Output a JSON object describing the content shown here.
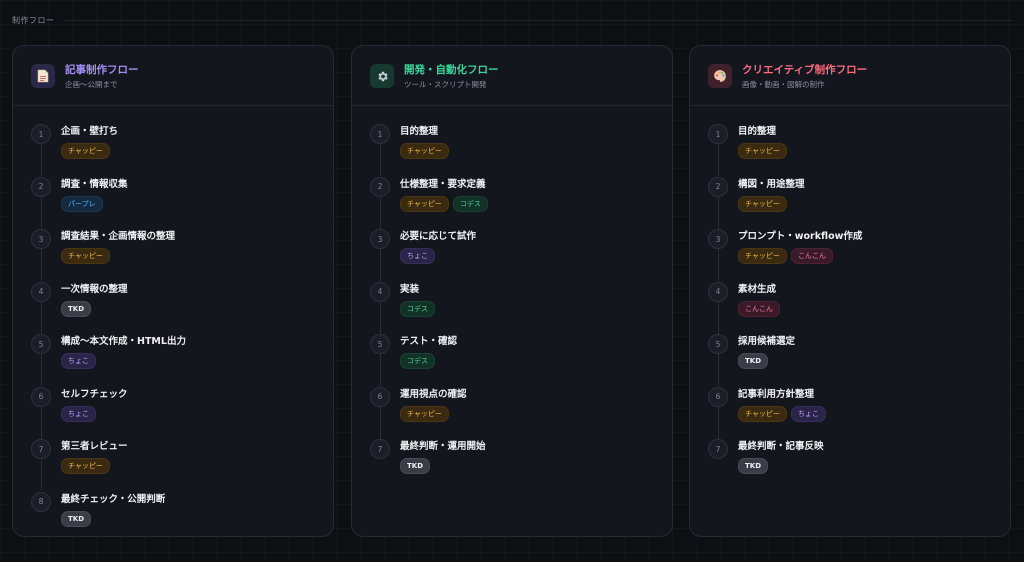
{
  "section": {
    "title": "制作フロー"
  },
  "colors": {
    "article": "#a48df0",
    "dev": "#39d59a",
    "creative": "#ff6b81"
  },
  "cards": [
    {
      "icon": "document-icon",
      "title": "記事制作フロー",
      "subtitle": "企画〜公開まで",
      "steps": [
        {
          "num": "1",
          "label": "企画・壁打ち",
          "tags": [
            "チャッピー"
          ]
        },
        {
          "num": "2",
          "label": "調査・情報収集",
          "tags": [
            "パープレ"
          ]
        },
        {
          "num": "3",
          "label": "調査結果・企画情報の整理",
          "tags": [
            "チャッピー"
          ]
        },
        {
          "num": "4",
          "label": "一次情報の整理",
          "tags": [
            "TKD"
          ]
        },
        {
          "num": "5",
          "label": "構成〜本文作成・HTML出力",
          "tags": [
            "ちょこ"
          ]
        },
        {
          "num": "6",
          "label": "セルフチェック",
          "tags": [
            "ちょこ"
          ]
        },
        {
          "num": "7",
          "label": "第三者レビュー",
          "tags": [
            "チャッピー"
          ]
        },
        {
          "num": "8",
          "label": "最終チェック・公開判断",
          "tags": [
            "TKD"
          ]
        }
      ]
    },
    {
      "icon": "gear-icon",
      "title": "開発・自動化フロー",
      "subtitle": "ツール・スクリプト開発",
      "steps": [
        {
          "num": "1",
          "label": "目的整理",
          "tags": [
            "チャッピー"
          ]
        },
        {
          "num": "2",
          "label": "仕様整理・要求定義",
          "tags": [
            "チャッピー",
            "コデス"
          ]
        },
        {
          "num": "3",
          "label": "必要に応じて試作",
          "tags": [
            "ちょこ"
          ]
        },
        {
          "num": "4",
          "label": "実装",
          "tags": [
            "コデス"
          ]
        },
        {
          "num": "5",
          "label": "テスト・確認",
          "tags": [
            "コデス"
          ]
        },
        {
          "num": "6",
          "label": "運用視点の確認",
          "tags": [
            "チャッピー"
          ]
        },
        {
          "num": "7",
          "label": "最終判断・運用開始",
          "tags": [
            "TKD"
          ]
        }
      ]
    },
    {
      "icon": "palette-icon",
      "title": "クリエイティブ制作フロー",
      "subtitle": "画像・動画・図解の制作",
      "steps": [
        {
          "num": "1",
          "label": "目的整理",
          "tags": [
            "チャッピー"
          ]
        },
        {
          "num": "2",
          "label": "構図・用途整理",
          "tags": [
            "チャッピー"
          ]
        },
        {
          "num": "3",
          "label": "プロンプト・workflow作成",
          "tags": [
            "チャッピー",
            "こんこん"
          ]
        },
        {
          "num": "4",
          "label": "素材生成",
          "tags": [
            "こんこん"
          ]
        },
        {
          "num": "5",
          "label": "採用候補選定",
          "tags": [
            "TKD"
          ]
        },
        {
          "num": "6",
          "label": "記事利用方針整理",
          "tags": [
            "チャッピー",
            "ちょこ"
          ]
        },
        {
          "num": "7",
          "label": "最終判断・記事反映",
          "tags": [
            "TKD"
          ]
        }
      ]
    }
  ]
}
